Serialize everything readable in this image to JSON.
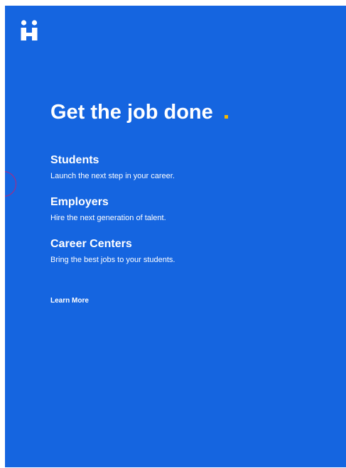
{
  "brand": {
    "logo_icon": "handshake-logo-icon"
  },
  "hero": {
    "headline": "Get the job done",
    "accent_color": "#f5b700"
  },
  "colors": {
    "background": "#1565e0",
    "text": "#ffffff"
  },
  "sections": [
    {
      "title": "Students",
      "description": "Launch the next step in your career."
    },
    {
      "title": "Employers",
      "description": "Hire the next generation of talent."
    },
    {
      "title": "Career Centers",
      "description": "Bring the best jobs to your students."
    }
  ],
  "cta": {
    "learn_more": "Learn More"
  }
}
